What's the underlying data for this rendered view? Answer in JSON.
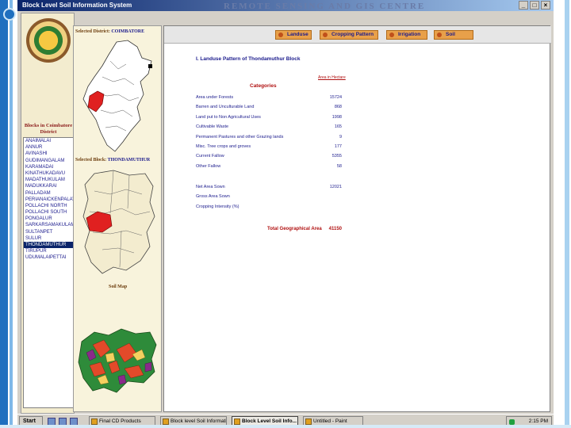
{
  "window": {
    "title": "Block Level Soil Information System",
    "banner": "REMOTE SENSING AND GIS CENTRE",
    "controls": [
      "_",
      "□",
      "×"
    ]
  },
  "left": {
    "emblem_label": "",
    "blocks_title_line1": "Blocks in Coimbatore",
    "blocks_title_line2": "District",
    "blocks": [
      "ANAIMALAI",
      "ANNUR",
      "AVINASHI",
      "GUDIMANGALAM",
      "KARAMADAI",
      "KINATHUKADAVU",
      "MADATHUKULAM",
      "MADUKKARAI",
      "PALLADAM",
      "PERIANAICKENPALAYAM",
      "POLLACHI NORTH",
      "POLLACHI SOUTH",
      "PONGALUR",
      "SARKARSAMAKULAM",
      "SULTANPET",
      "SULUR",
      "THONDAMUTHUR",
      "TIRUPUR",
      "UDUMALAIPETTAI"
    ],
    "selected_block": "THONDAMUTHUR"
  },
  "middle": {
    "district_label": "Selected District:",
    "district_value": "COIMBATORE",
    "block_label": "Selected Block:",
    "block_value": "THONDAMUTHUR",
    "soil_label": "Soil Map"
  },
  "tabs": [
    "Landuse",
    "Cropping Pattern",
    "Irrigation",
    "Soil"
  ],
  "content": {
    "title": "I. Landuse Pattern of Thondamuthur Block",
    "unit": "Area in Hectare",
    "categories_heading": "Categories",
    "rows": [
      {
        "label": "Area under Forests",
        "value": "15724"
      },
      {
        "label": "Barren and Unculturable Land",
        "value": "868"
      },
      {
        "label": "Land put to Non Agricultural Uses",
        "value": "1998"
      },
      {
        "label": "Cultivable Waste",
        "value": "165"
      },
      {
        "label": "Permanent Pastures and other Grazing lands",
        "value": "9"
      },
      {
        "label": "Misc. Tree crops and groves",
        "value": "177"
      },
      {
        "label": "Current Fallow",
        "value": "5355"
      },
      {
        "label": "Other Fallow",
        "value": "58"
      }
    ],
    "rows2": [
      {
        "label": "Net Area Sown",
        "value": "12021"
      },
      {
        "label": "Gross Area Sown",
        "value": ""
      },
      {
        "label": "Cropping Intensity (%)",
        "value": ""
      }
    ],
    "total_label": "Total Geographical Area",
    "total_value": "41150"
  },
  "taskbar": {
    "start": "Start",
    "tasks": [
      "Final CD Products",
      "Block level Soil Informatio...",
      "Block Level Soil Info...",
      "Untitled - Paint"
    ],
    "active_task_index": 2,
    "clock": "2:15 PM"
  },
  "colors": {
    "accent": "#1f6fbf",
    "selected_district": "#e02020",
    "tab_bg": "#e8a04a",
    "heading_red": "#b01010",
    "text_blue": "#1a1a8c"
  }
}
